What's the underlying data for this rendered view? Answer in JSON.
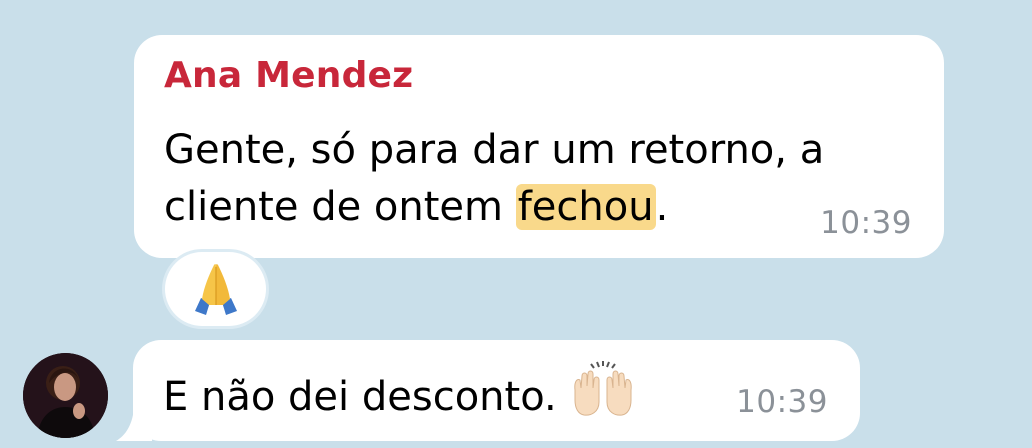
{
  "message1": {
    "sender": "Ana Mendez",
    "line1": "Gente, só para dar um retorno, a",
    "line2_before": "cliente de ontem ",
    "line2_highlight": "fechou",
    "line2_after": ".",
    "time": "10:39",
    "reaction_icon": "folded-hands-emoji"
  },
  "message2": {
    "text": "E não dei desconto.",
    "emoji_icon": "raising-hands-emoji",
    "time": "10:39"
  },
  "colors": {
    "background": "#c9dfea",
    "sender_name": "#c8273a",
    "highlight": "#f9d98b",
    "timestamp": "#8b9198"
  }
}
